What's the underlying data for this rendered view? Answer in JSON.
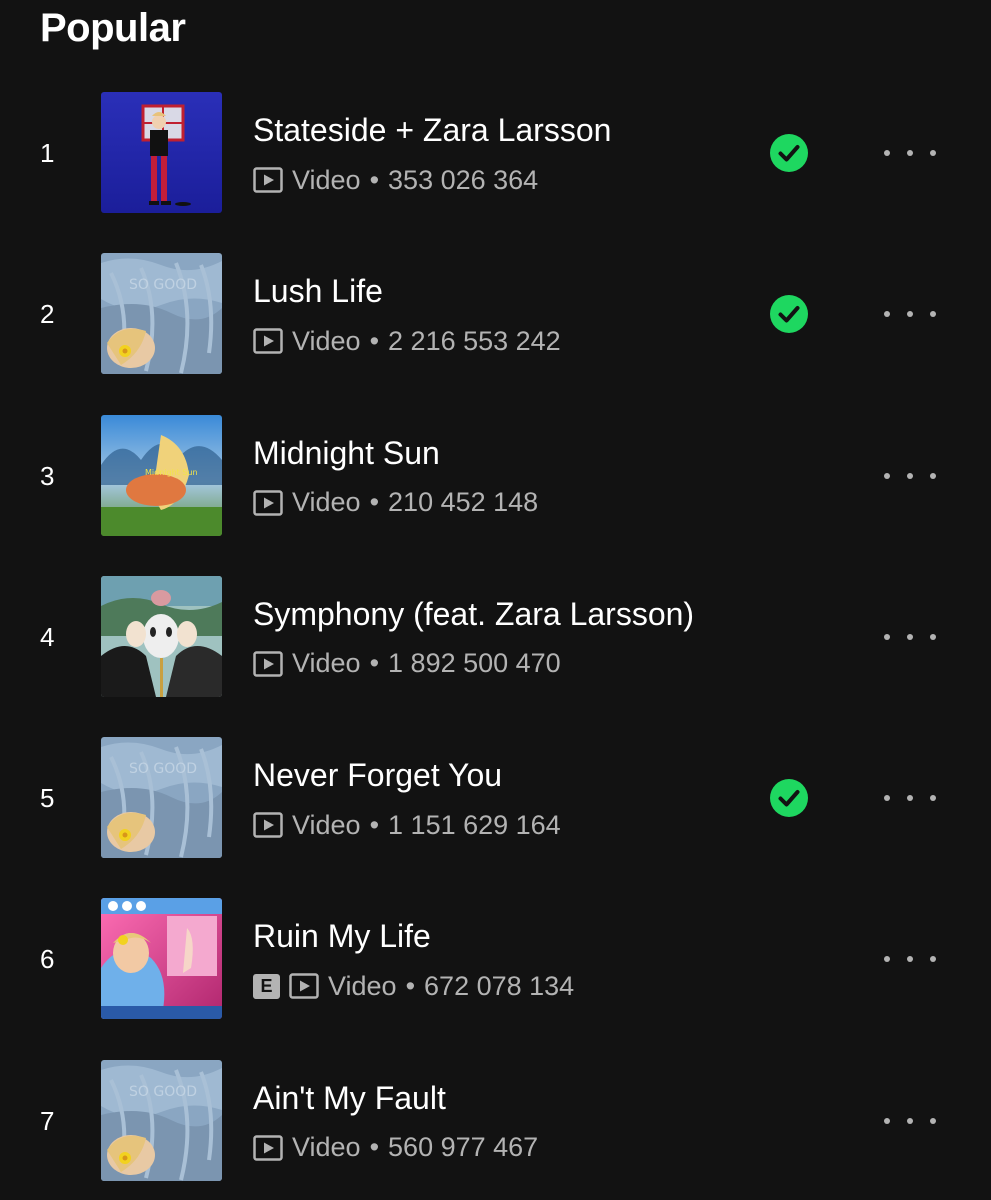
{
  "section": {
    "title": "Popular"
  },
  "colors": {
    "accent": "#1ed760",
    "background": "#121212",
    "muted": "#b3b3b3"
  },
  "tracks": [
    {
      "rank": "1",
      "title": "Stateside + Zara Larsson",
      "type": "Video",
      "plays": "353 026 364",
      "explicit": false,
      "saved": true,
      "cover": "stateside-cover"
    },
    {
      "rank": "2",
      "title": "Lush Life",
      "type": "Video",
      "plays": "2 216 553 242",
      "explicit": false,
      "saved": true,
      "cover": "so-good-cover"
    },
    {
      "rank": "3",
      "title": "Midnight Sun",
      "type": "Video",
      "plays": "210 452 148",
      "explicit": false,
      "saved": false,
      "cover": "midnight-sun-cover"
    },
    {
      "rank": "4",
      "title": "Symphony (feat. Zara Larsson)",
      "type": "Video",
      "plays": "1 892 500 470",
      "explicit": false,
      "saved": false,
      "cover": "symphony-cover"
    },
    {
      "rank": "5",
      "title": "Never Forget You",
      "type": "Video",
      "plays": "1 151 629 164",
      "explicit": false,
      "saved": true,
      "cover": "so-good-cover"
    },
    {
      "rank": "6",
      "title": "Ruin My Life",
      "type": "Video",
      "plays": "672 078 134",
      "explicit": true,
      "explicit_label": "E",
      "saved": false,
      "cover": "ruin-my-life-cover"
    },
    {
      "rank": "7",
      "title": "Ain't My Fault",
      "type": "Video",
      "plays": "560 977 467",
      "explicit": false,
      "saved": false,
      "cover": "so-good-cover"
    }
  ]
}
